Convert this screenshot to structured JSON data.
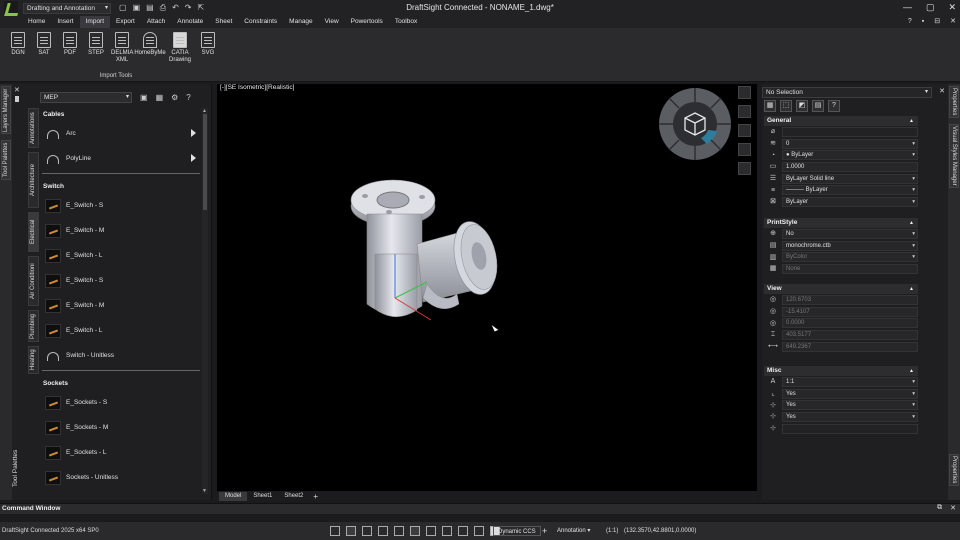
{
  "app": {
    "title": "DraftSight Connected - NONAME_1.dwg*",
    "workspace": "Drafting and Annotation",
    "window_controls": [
      "—",
      "▢",
      "✕"
    ]
  },
  "menu": {
    "items": [
      "Home",
      "Insert",
      "Import",
      "Export",
      "Attach",
      "Annotate",
      "Sheet",
      "Constraints",
      "Manage",
      "View",
      "Powertools",
      "Toolbox"
    ],
    "active": "Import",
    "right": [
      "?",
      "▪",
      "⊟",
      "✕"
    ]
  },
  "ribbon": {
    "tools": [
      {
        "label": "DGN"
      },
      {
        "label": "SAT"
      },
      {
        "label": "PDF"
      },
      {
        "label": "STEP"
      },
      {
        "label": "DELMIA XML"
      },
      {
        "label": "HomeByMe"
      },
      {
        "label": "CATIA Drawing"
      },
      {
        "label": "SVG"
      }
    ],
    "group_label": "Import Tools"
  },
  "left_strip": {
    "layers_manager": "Layers Manager",
    "tool_palettes": "Tool Palettes",
    "bottom_label": "Tool Palettes"
  },
  "palette": {
    "selected": "MEP",
    "side_tabs": [
      "Annotations",
      "Architecture",
      "Electrical",
      "Air Conditioni",
      "Plumbing",
      "Heating"
    ],
    "sections": [
      {
        "title": "Cables",
        "items": [
          {
            "name": "Arc",
            "arrow": true,
            "plain": true
          },
          {
            "name": "PolyLine",
            "arrow": true,
            "plain": true
          }
        ]
      },
      {
        "title": "Switch",
        "items": [
          {
            "name": "E_Switch - S"
          },
          {
            "name": "E_Switch - M"
          },
          {
            "name": "E_Switch - L"
          },
          {
            "name": "E_Switch - S"
          },
          {
            "name": "E_Switch - M"
          },
          {
            "name": "E_Switch - L"
          },
          {
            "name": "Switch - Unitless",
            "plain": true
          }
        ]
      },
      {
        "title": "Sockets",
        "items": [
          {
            "name": "E_Sockets - S"
          },
          {
            "name": "E_Sockets - M"
          },
          {
            "name": "E_Sockets - L"
          },
          {
            "name": "Sockets - Unitless"
          }
        ]
      }
    ]
  },
  "viewport": {
    "label": "[-][SE Isometric][Realistic]",
    "sheets": [
      "Model",
      "Sheet1",
      "Sheet2"
    ],
    "active_sheet": "Model"
  },
  "properties": {
    "selection": "No Selection",
    "side_labels": [
      "Properties",
      "Visual Styles Manager",
      "Properties"
    ],
    "groups": [
      {
        "title": "General",
        "rows": [
          {
            "icon": "⌀",
            "value": "",
            "dd": false
          },
          {
            "icon": "≋",
            "value": "0",
            "dd": true
          },
          {
            "icon": "◔",
            "value": "● ByLayer",
            "dd": true
          },
          {
            "icon": "▭",
            "value": "1.0000",
            "dd": false
          },
          {
            "icon": "☰",
            "value": "ByLayer     Solid line",
            "dd": true
          },
          {
            "icon": "≡",
            "value": "——— ByLayer",
            "dd": true
          },
          {
            "icon": "⊠",
            "value": "ByLayer",
            "dd": true
          }
        ]
      },
      {
        "title": "PrintStyle",
        "rows": [
          {
            "icon": "⊕",
            "value": "No",
            "dd": true
          },
          {
            "icon": "▤",
            "value": "monochrome.ctb",
            "dd": true
          },
          {
            "icon": "▥",
            "value": "ByColor",
            "dd": true,
            "dim": true
          },
          {
            "icon": "▦",
            "value": "None",
            "dd": false,
            "dim": true
          }
        ]
      },
      {
        "title": "View",
        "rows": [
          {
            "icon": "◎",
            "value": "120.6703",
            "dim": true
          },
          {
            "icon": "◎",
            "value": "-15.4107",
            "dim": true
          },
          {
            "icon": "◎",
            "value": "0.0000",
            "dim": true
          },
          {
            "icon": "⌶",
            "value": "403.5177",
            "dim": true
          },
          {
            "icon": "⟷",
            "value": "649.2367",
            "dim": true
          }
        ]
      },
      {
        "title": "Misc",
        "rows": [
          {
            "icon": "A",
            "value": "1:1",
            "dd": true
          },
          {
            "icon": "⌞",
            "value": "Yes",
            "dd": true
          },
          {
            "icon": "⊹",
            "value": "Yes",
            "dd": true
          },
          {
            "icon": "⊹",
            "value": "Yes",
            "dd": true
          },
          {
            "icon": "⊹",
            "value": "",
            "dd": false,
            "empty": true
          }
        ]
      }
    ]
  },
  "command_window": {
    "label": "Command Window"
  },
  "status": {
    "version": "DraftSight Connected 2025  x64 SP0",
    "dynamic_ccs": "Dynamic CCS",
    "annotation": "Annotation",
    "scale": "(1:1)",
    "coordinates": "(132.3570,42.8801,0.0000)"
  },
  "colors": {
    "background": "#000000",
    "panel": "#1f1f21",
    "accent_teal": "#2f7d9c",
    "logo_green": "#8bc34a"
  }
}
